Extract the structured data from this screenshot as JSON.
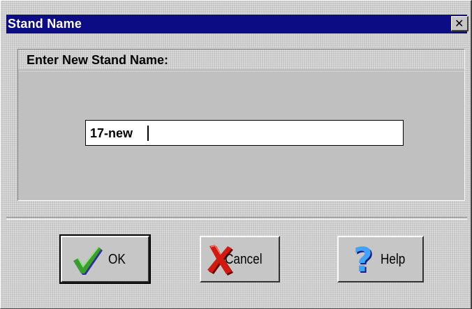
{
  "window": {
    "title": "Stand Name",
    "close_icon": "close-x-icon"
  },
  "group": {
    "label": "Enter New Stand Name:"
  },
  "name_input": {
    "value": "17-new"
  },
  "buttons": {
    "ok": {
      "label": "OK",
      "icon": "green-checkmark-icon"
    },
    "cancel": {
      "label": "Cancel",
      "icon": "red-x-icon"
    },
    "help": {
      "label": "Help",
      "icon": "question-mark-icon"
    }
  },
  "colors": {
    "titlebar": "#0c0c84",
    "dialog_face": "#c6c6c6",
    "ok_icon": "#3a9e2e",
    "cancel_icon": "#d41a10",
    "help_icon": "#3fa3ff"
  }
}
